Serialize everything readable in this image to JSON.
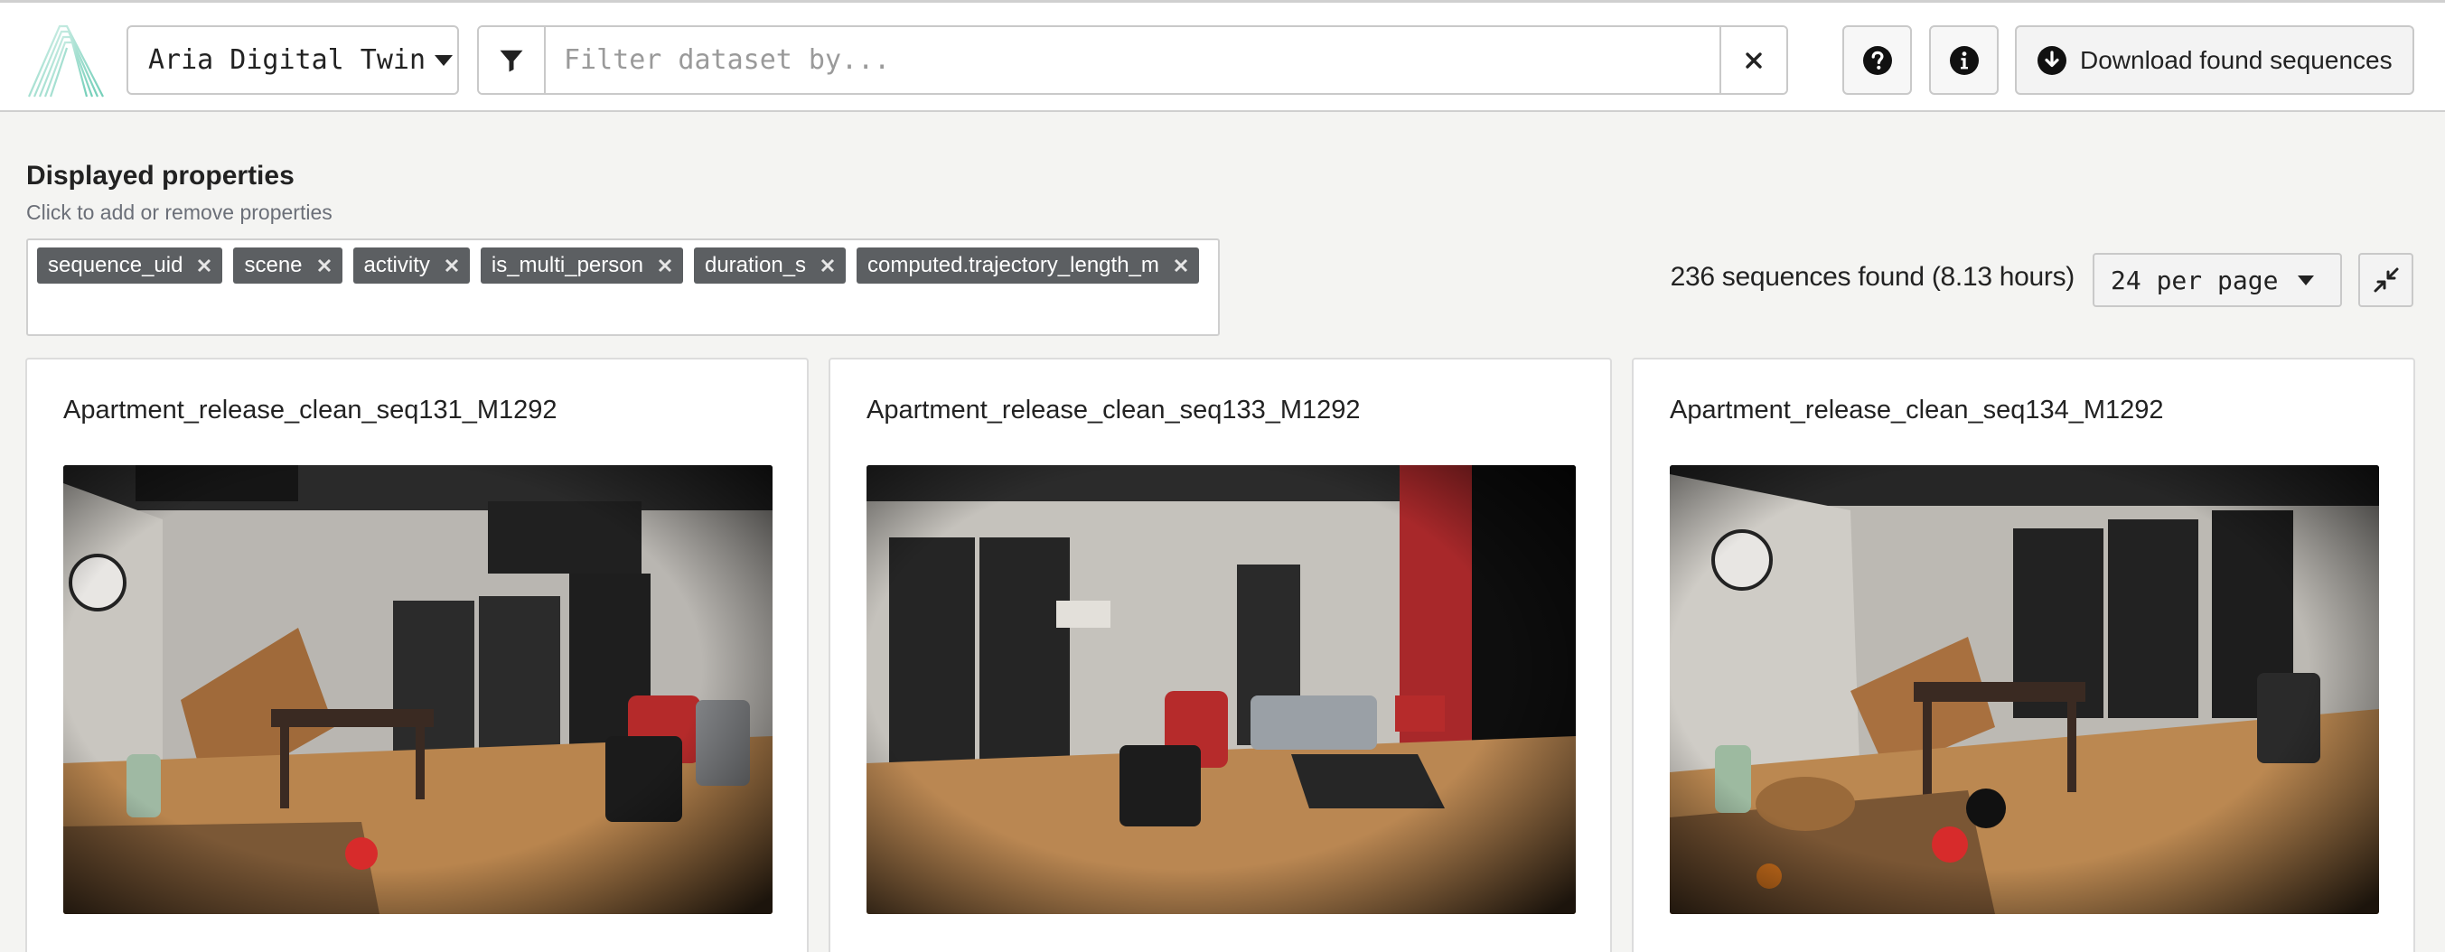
{
  "header": {
    "logo_icon": "aria-logo-icon",
    "dataset_selector": {
      "value": "Aria Digital Twin"
    },
    "filter": {
      "icon": "filter-icon",
      "placeholder": "Filter dataset by...",
      "value": "",
      "clear_icon": "close-icon"
    },
    "help_icon": "question-circle-icon",
    "info_icon": "info-circle-icon",
    "download": {
      "label": "Download found sequences",
      "icon": "download-circle-icon"
    }
  },
  "properties": {
    "title": "Displayed properties",
    "subtitle": "Click to add or remove properties",
    "chips": [
      {
        "label": "sequence_uid"
      },
      {
        "label": "scene"
      },
      {
        "label": "activity"
      },
      {
        "label": "is_multi_person"
      },
      {
        "label": "duration_s"
      },
      {
        "label": "computed.trajectory_length_m"
      }
    ]
  },
  "results": {
    "found_text": "236 sequences found (8.13 hours)",
    "per_page": {
      "value": "24 per page"
    },
    "collapse_icon": "collapse-arrows-icon"
  },
  "cards": [
    {
      "title": "Apartment_release_clean_seq131_M1292"
    },
    {
      "title": "Apartment_release_clean_seq133_M1292"
    },
    {
      "title": "Apartment_release_clean_seq134_M1292"
    }
  ],
  "colors": {
    "page_bg": "#f4f4f2",
    "chip_bg": "#5c5f62",
    "logo_gradient_start": "#c5ece1",
    "logo_gradient_end": "#6fcfb8"
  }
}
